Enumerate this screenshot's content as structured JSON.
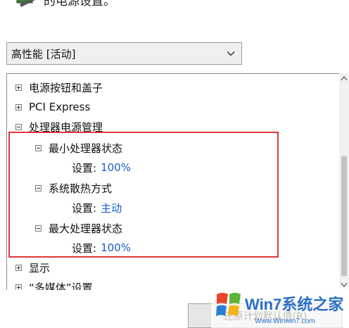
{
  "header": {
    "partial_text": "的电源设置。",
    "icon": "power-options-icon"
  },
  "plan_select": {
    "value": "高性能 [活动]",
    "icon": "chevron-down-icon"
  },
  "tree": {
    "items": [
      {
        "label": "电源按钮和盖子",
        "expander": "plus"
      },
      {
        "label": "PCI Express",
        "expander": "plus"
      },
      {
        "label": "处理器电源管理",
        "expander": "minus"
      },
      {
        "label": "最小处理器状态",
        "expander": "minus",
        "setting_label": "设置:",
        "setting_value": "100%"
      },
      {
        "label": "系统散热方式",
        "expander": "minus",
        "setting_label": "设置:",
        "setting_value": "主动"
      },
      {
        "label": "最大处理器状态",
        "expander": "minus",
        "setting_label": "设置:",
        "setting_value": "100%"
      },
      {
        "label": "显示",
        "expander": "plus"
      },
      {
        "label": "“多媒体”设置",
        "expander": "plus"
      }
    ]
  },
  "restore_button": {
    "label": "还原计划默认值(R)"
  },
  "watermark": {
    "brand": "Win7系统之家",
    "url": "Www.Winwin7.com"
  },
  "colors": {
    "highlight_frame": "#e23636",
    "setting_value": "#1a5fc6"
  }
}
